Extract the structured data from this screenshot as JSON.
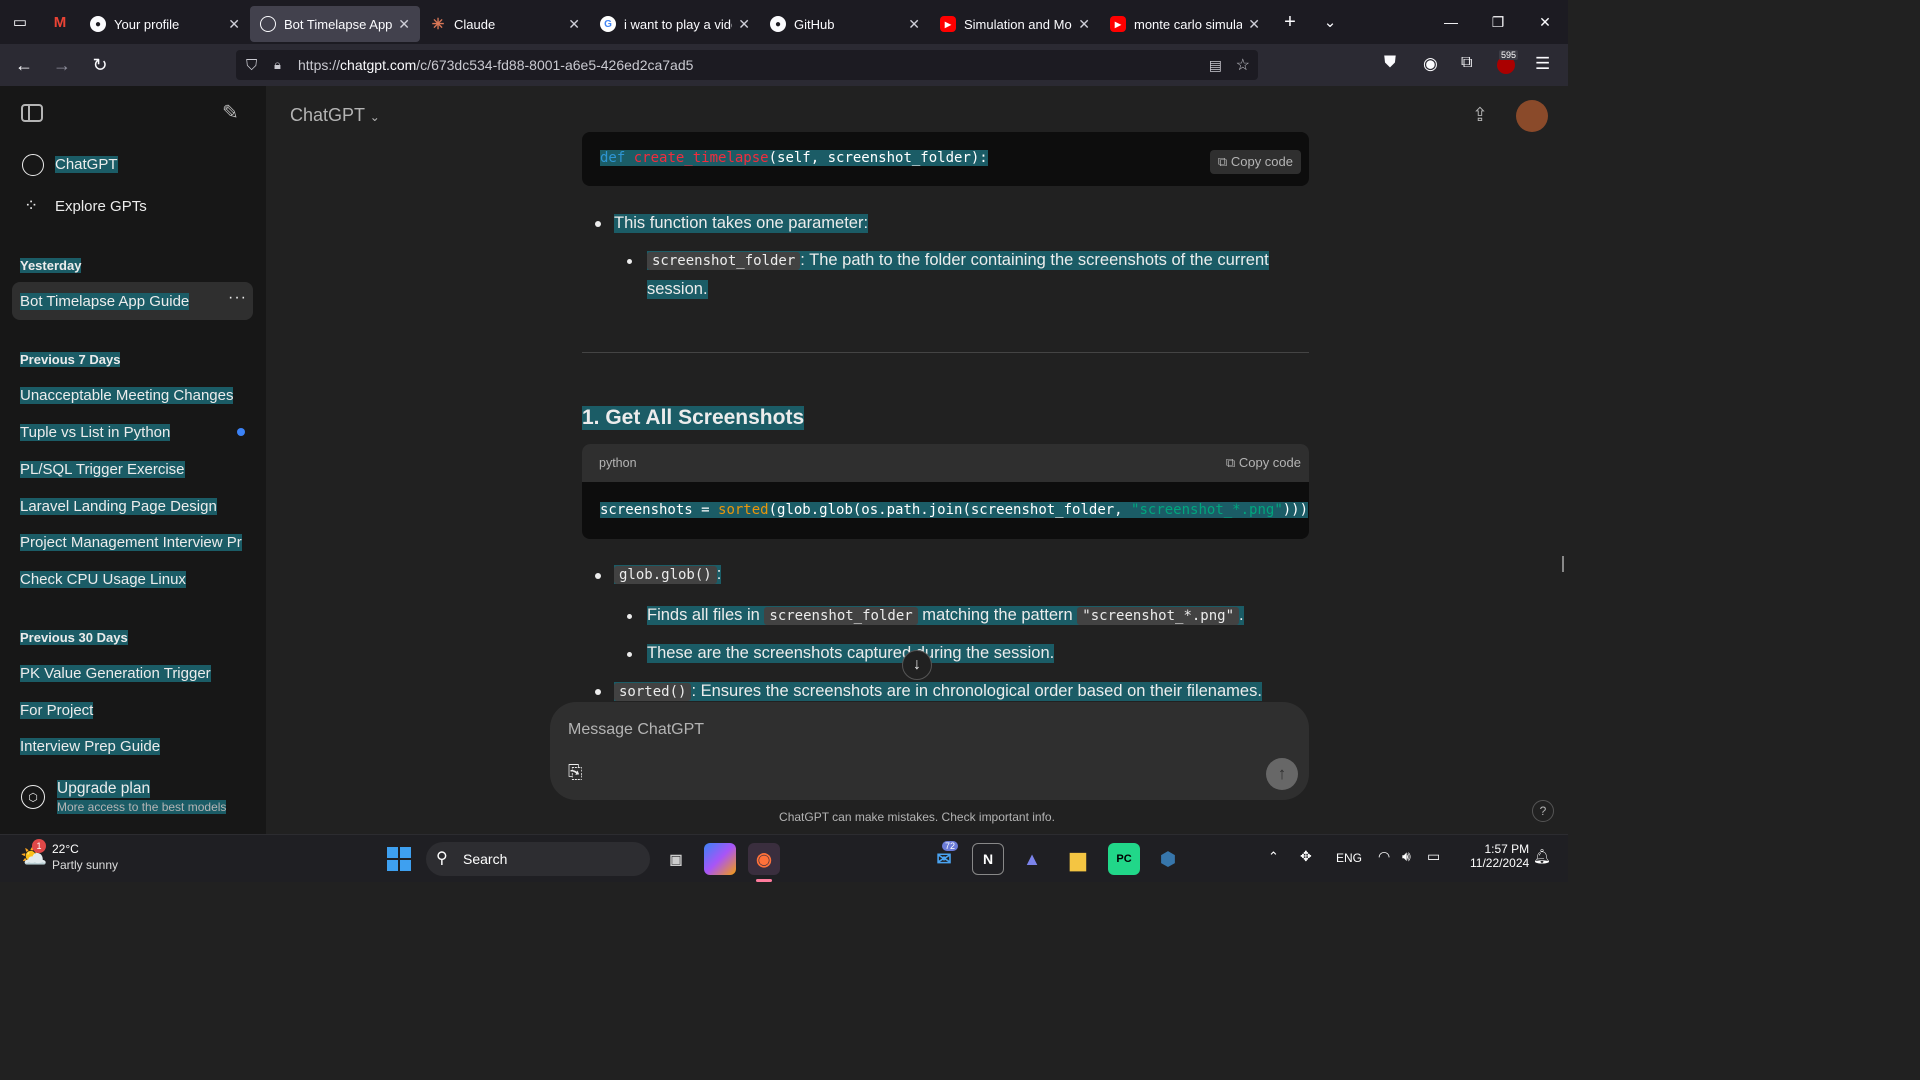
{
  "browser": {
    "tabs": [
      {
        "title": "Your profile",
        "active": false
      },
      {
        "title": "Bot Timelapse App G",
        "active": true
      },
      {
        "title": "Claude",
        "active": false
      },
      {
        "title": "i want to play a vide",
        "active": false
      },
      {
        "title": "GitHub",
        "active": false
      },
      {
        "title": "Simulation and Mod",
        "active": false
      },
      {
        "title": "monte carlo simulati",
        "active": false
      }
    ],
    "url_prefix": "https://",
    "url_domain": "chatgpt.com",
    "url_path": "/c/673dc534-fd88-8001-a6e5-426ed2ca7ad5",
    "ext_badge": "595"
  },
  "sidebar": {
    "top_items": [
      {
        "label": "ChatGPT"
      },
      {
        "label": "Explore GPTs"
      }
    ],
    "sections": [
      {
        "heading": "Yesterday",
        "items": [
          "Bot Timelapse App Guide"
        ]
      },
      {
        "heading": "Previous 7 Days",
        "items": [
          "Unacceptable Meeting Changes",
          "Tuple vs List in Python",
          "PL/SQL Trigger Exercise",
          "Laravel Landing Page Design",
          "Project Management Interview Prep",
          "Check CPU Usage Linux"
        ]
      },
      {
        "heading": "Previous 30 Days",
        "items": [
          "PK Value Generation Trigger",
          "For Project",
          "Interview Prep Guide"
        ]
      }
    ],
    "upgrade_title": "Upgrade plan",
    "upgrade_sub": "More access to the best models"
  },
  "header": {
    "model": "ChatGPT"
  },
  "content": {
    "code1": {
      "kw": "def",
      "fn": "create_timelapse",
      "rest": "(self, screenshot_folder):",
      "copy": "Copy code"
    },
    "para1": "This function takes one parameter:",
    "param_code": "screenshot_folder",
    "param_desc_1": ": The path to the folder containing the screenshots of the current",
    "param_desc_2": "session.",
    "heading": "1. Get All Screenshots",
    "code2": {
      "lang": "python",
      "copy": "Copy code",
      "a": "screenshots = ",
      "b": "sorted",
      "c": "(glob.glob(os.path.join(screenshot_folder, ",
      "d": "\"screenshot_*.png\"",
      "e": ")))"
    },
    "b1_code": "glob.glob()",
    "b1_colon": ":",
    "b1a_pre": "Finds all files in ",
    "b1a_code1": "screenshot_folder",
    "b1a_mid": " matching the pattern ",
    "b1a_code2": "\"screenshot_*.png\"",
    "b1a_end": ".",
    "b1b": "These are the screenshots captured during the session.",
    "b2_code": "sorted()",
    "b2_text": ": Ensures the screenshots are in chronological order based on their filenames."
  },
  "composer": {
    "placeholder": "Message ChatGPT",
    "disclaimer": "ChatGPT can make mistakes. Check important info.",
    "help": "?"
  },
  "taskbar": {
    "weather_temp": "22°C",
    "weather_desc": "Partly sunny",
    "weather_badge": "1",
    "search": "Search",
    "mail_badge": "72",
    "lang": "ENG",
    "time": "1:57 PM",
    "date": "11/22/2024"
  }
}
